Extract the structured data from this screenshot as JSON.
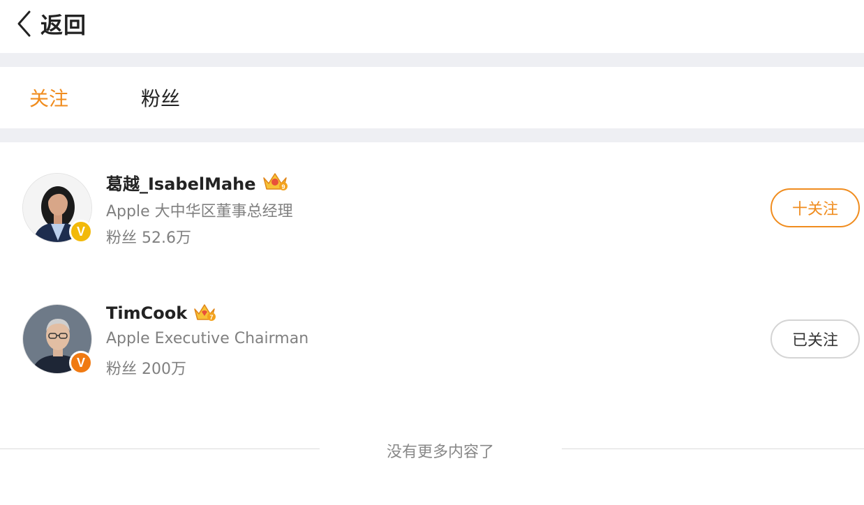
{
  "header": {
    "back_label": "返回"
  },
  "tabs": [
    {
      "label": "关注",
      "active": true
    },
    {
      "label": "粉丝",
      "active": false
    }
  ],
  "users": [
    {
      "name": "葛越_IsabelMahe",
      "description": "Apple 大中华区董事总经理",
      "fans": "粉丝 52.6万",
      "button_label": "十关注",
      "button_state": "follow",
      "verify_badge": "V",
      "verify_color": "#f2b90a",
      "crown_level": "9"
    },
    {
      "name": "TimCook",
      "description": "Apple Executive Chairman",
      "fans": "粉丝 200万",
      "button_label": "已关注",
      "button_state": "followed",
      "verify_badge": "V",
      "verify_color": "#f07a12",
      "crown_level": "7"
    }
  ],
  "footer": {
    "text": "没有更多内容了"
  },
  "colors": {
    "accent": "#f08c1e",
    "divider": "#eeeff3"
  }
}
